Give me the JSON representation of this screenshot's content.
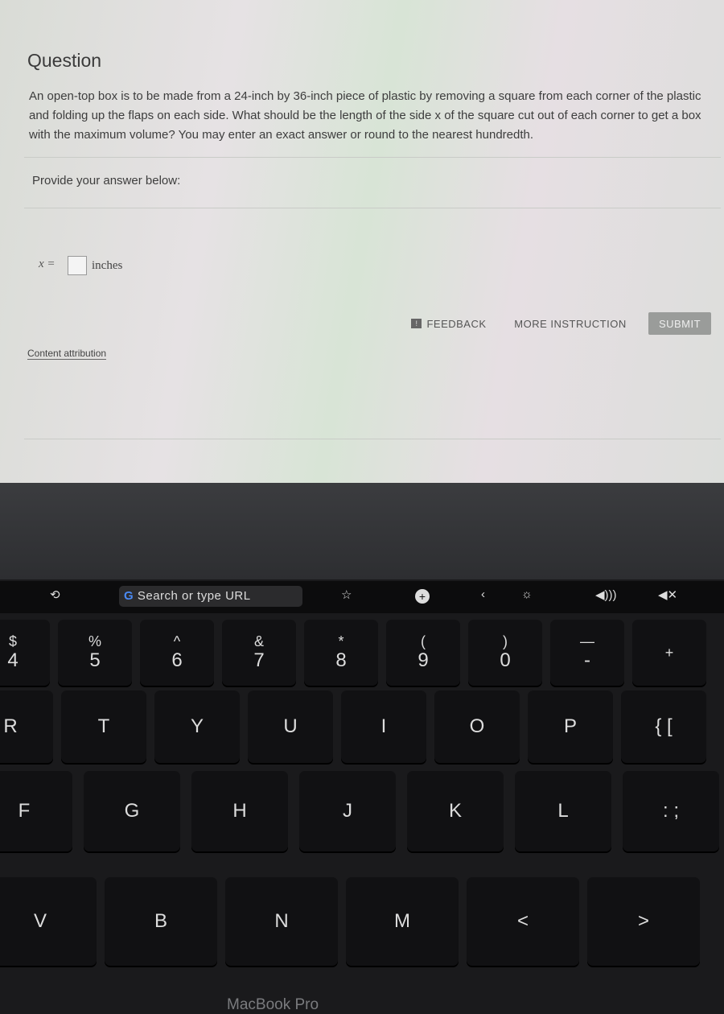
{
  "question": {
    "title": "Question",
    "text": "An open-top box is to be made from a 24-inch by 36-inch piece of plastic by removing a square from each corner of the plastic and folding up the flaps on each side. What should be the length of the side x of the square cut out of each corner to get a box with the maximum volume? You may enter an exact answer or round to the nearest hundredth.",
    "provide_label": "Provide your answer below:",
    "answer_prefix": "x =",
    "answer_value": "",
    "answer_units": "inches",
    "feedback_label": "FEEDBACK",
    "more_instruction_label": "MORE INSTRUCTION",
    "submit_label": "SUBMIT",
    "content_attribution": "Content attribution"
  },
  "laptop": {
    "brand": "MacBook Pro",
    "touchbar": {
      "url_placeholder": "Search or type URL",
      "url_logo": "G",
      "icons": [
        "reload-icon",
        "star-icon",
        "new-tab-icon",
        "back-icon",
        "brightness-icon",
        "volume-icon",
        "mute-icon"
      ]
    },
    "keys": {
      "row1": [
        {
          "top": "$",
          "main": "4"
        },
        {
          "top": "%",
          "main": "5"
        },
        {
          "top": "^",
          "main": "6"
        },
        {
          "top": "&",
          "main": "7"
        },
        {
          "top": "*",
          "main": "8"
        },
        {
          "top": "(",
          "main": "9"
        },
        {
          "top": ")",
          "main": "0"
        },
        {
          "top": "—",
          "main": "-"
        },
        {
          "top": "+",
          "main": ""
        }
      ],
      "row2": [
        "R",
        "T",
        "Y",
        "U",
        "I",
        "O",
        "P",
        "{ ["
      ],
      "row3": [
        "F",
        "G",
        "H",
        "J",
        "K",
        "L",
        ": ;"
      ],
      "row4": [
        "V",
        "B",
        "N",
        "M",
        "<",
        ">"
      ]
    }
  }
}
